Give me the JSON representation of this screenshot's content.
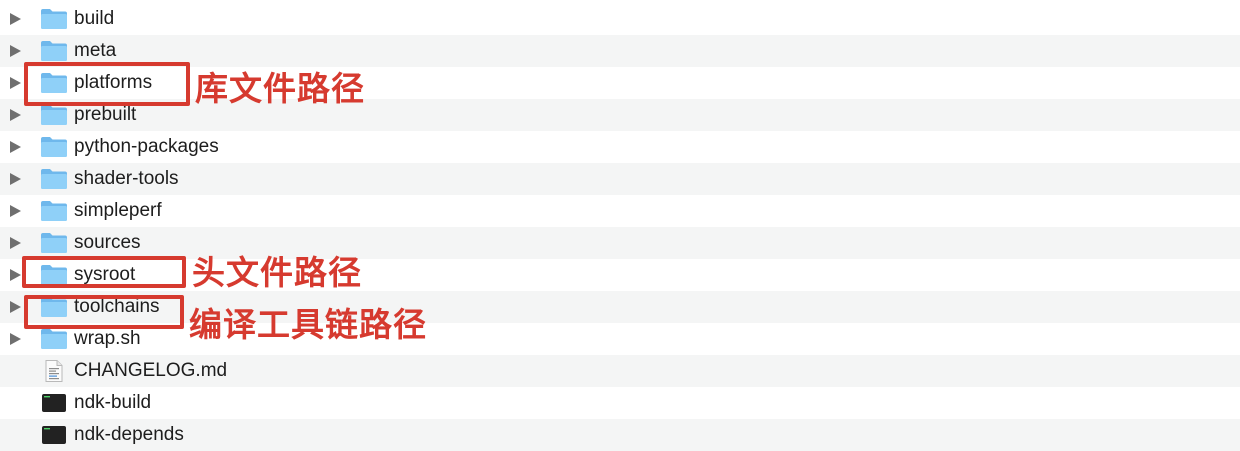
{
  "rows": [
    {
      "name": "build",
      "kind": "folder",
      "expandable": true
    },
    {
      "name": "meta",
      "kind": "folder",
      "expandable": true
    },
    {
      "name": "platforms",
      "kind": "folder",
      "expandable": true
    },
    {
      "name": "prebuilt",
      "kind": "folder",
      "expandable": true
    },
    {
      "name": "python-packages",
      "kind": "folder",
      "expandable": true
    },
    {
      "name": "shader-tools",
      "kind": "folder",
      "expandable": true
    },
    {
      "name": "simpleperf",
      "kind": "folder",
      "expandable": true
    },
    {
      "name": "sources",
      "kind": "folder",
      "expandable": true
    },
    {
      "name": "sysroot",
      "kind": "folder",
      "expandable": true
    },
    {
      "name": "toolchains",
      "kind": "folder",
      "expandable": true
    },
    {
      "name": "wrap.sh",
      "kind": "folder",
      "expandable": true
    },
    {
      "name": "CHANGELOG.md",
      "kind": "document",
      "expandable": false
    },
    {
      "name": "ndk-build",
      "kind": "executable",
      "expandable": false
    },
    {
      "name": "ndk-depends",
      "kind": "executable",
      "expandable": false
    }
  ],
  "annotations": [
    {
      "target": "platforms",
      "text": "库文件路径"
    },
    {
      "target": "sysroot",
      "text": "头文件路径"
    },
    {
      "target": "toolchains",
      "text": "编译工具链路径"
    }
  ],
  "colors": {
    "annotation": "#d63a2f",
    "folder": "#7cc3f2",
    "row_alt": "#f4f5f5"
  },
  "icons": {
    "folder": "folder-icon",
    "document": "document-icon",
    "executable": "terminal-executable-icon",
    "disclosure": "disclosure-triangle-icon"
  }
}
